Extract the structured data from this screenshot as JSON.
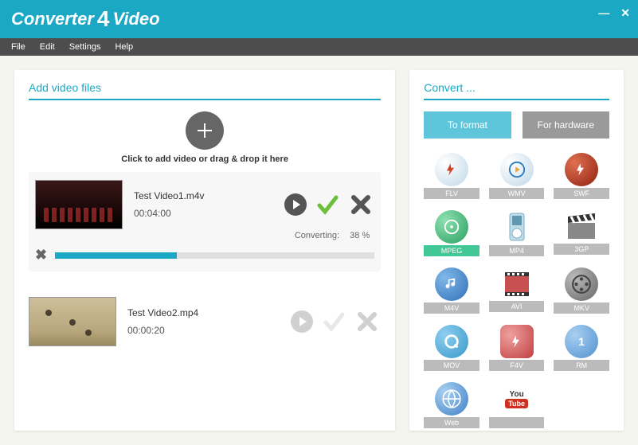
{
  "app": {
    "title_pre": "Converter",
    "title_mid": "4",
    "title_post": "Video"
  },
  "menu": {
    "file": "File",
    "edit": "Edit",
    "settings": "Settings",
    "help": "Help"
  },
  "left_panel": {
    "header": "Add video files",
    "hint": "Click to add video or drag & drop it here"
  },
  "items": [
    {
      "name": "Test Video1.m4v",
      "duration": "00:04:00",
      "status_label": "Converting:",
      "percent_text": "38 %",
      "percent": 38,
      "active": true
    },
    {
      "name": "Test Video2.mp4",
      "duration": "00:00:20",
      "active": false
    }
  ],
  "right_panel": {
    "header": "Convert ...",
    "tab_format": "To format",
    "tab_hardware": "For hardware"
  },
  "formats": {
    "flv": "FLV",
    "wmv": "WMV",
    "swf": "SWF",
    "mpeg": "MPEG",
    "mp4": "MP4",
    "gp3": "3GP",
    "m4v": "M4V",
    "avi": "AVI",
    "mkv": "MKV",
    "mov": "MOV",
    "f4v": "F4V",
    "rm": "RM",
    "web": "Web",
    "youtube": "You"
  }
}
